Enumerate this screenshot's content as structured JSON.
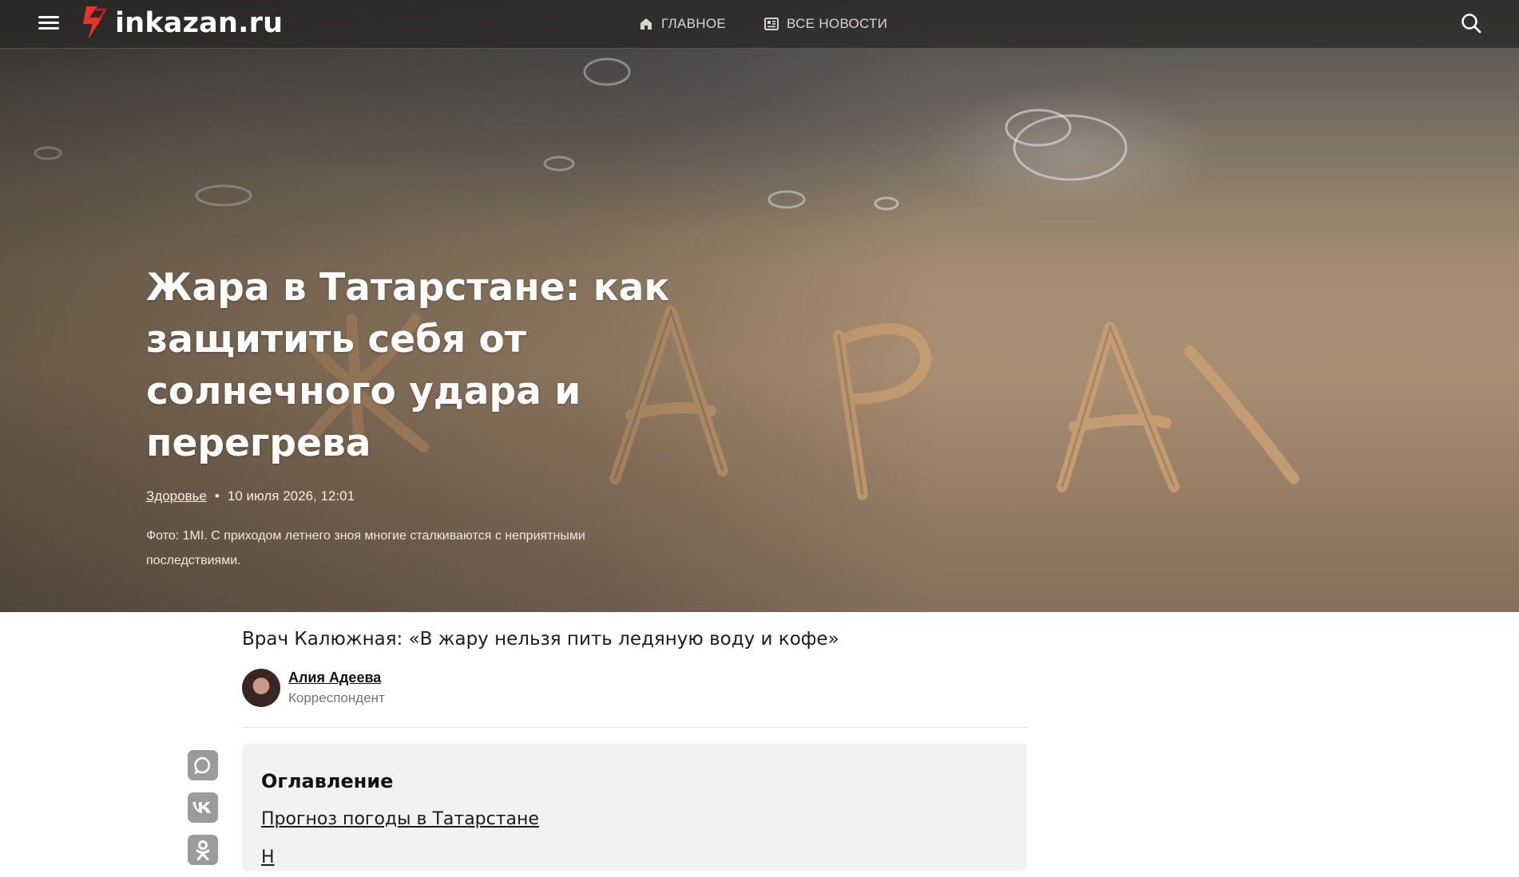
{
  "site": {
    "logo_text": "inkazan.ru"
  },
  "nav": {
    "items": [
      {
        "label": "Главное",
        "icon": "home-icon"
      },
      {
        "label": "Все новости",
        "icon": "newspaper-icon"
      }
    ]
  },
  "hero": {
    "title": "Жара в Татарстане: как защитить себя от солнечного удара и перегрева",
    "category": "Здоровье",
    "date": "10 июля 2026, 12:01",
    "caption": "Фото: 1MI. С приходом летнего зноя многие сталкиваются с неприятными последствиями."
  },
  "article": {
    "subtitle": "Врач Калюжная: «В жару нельзя пить ледяную воду и кофе»",
    "author": {
      "name": "Алия Адеева",
      "role": "Корреспондент"
    },
    "share": [
      {
        "icon": "max-messenger-icon"
      },
      {
        "icon": "vk-icon"
      },
      {
        "icon": "odnoklassniki-icon"
      }
    ],
    "toc": {
      "title": "Оглавление",
      "items": [
        {
          "label": "Прогноз погоды в Татарстане"
        },
        {
          "label": "Н"
        }
      ]
    }
  },
  "colors": {
    "logo_accent": "#e8322a",
    "share_bg": "#9b9b9b",
    "toc_bg": "#f2f2f2"
  }
}
